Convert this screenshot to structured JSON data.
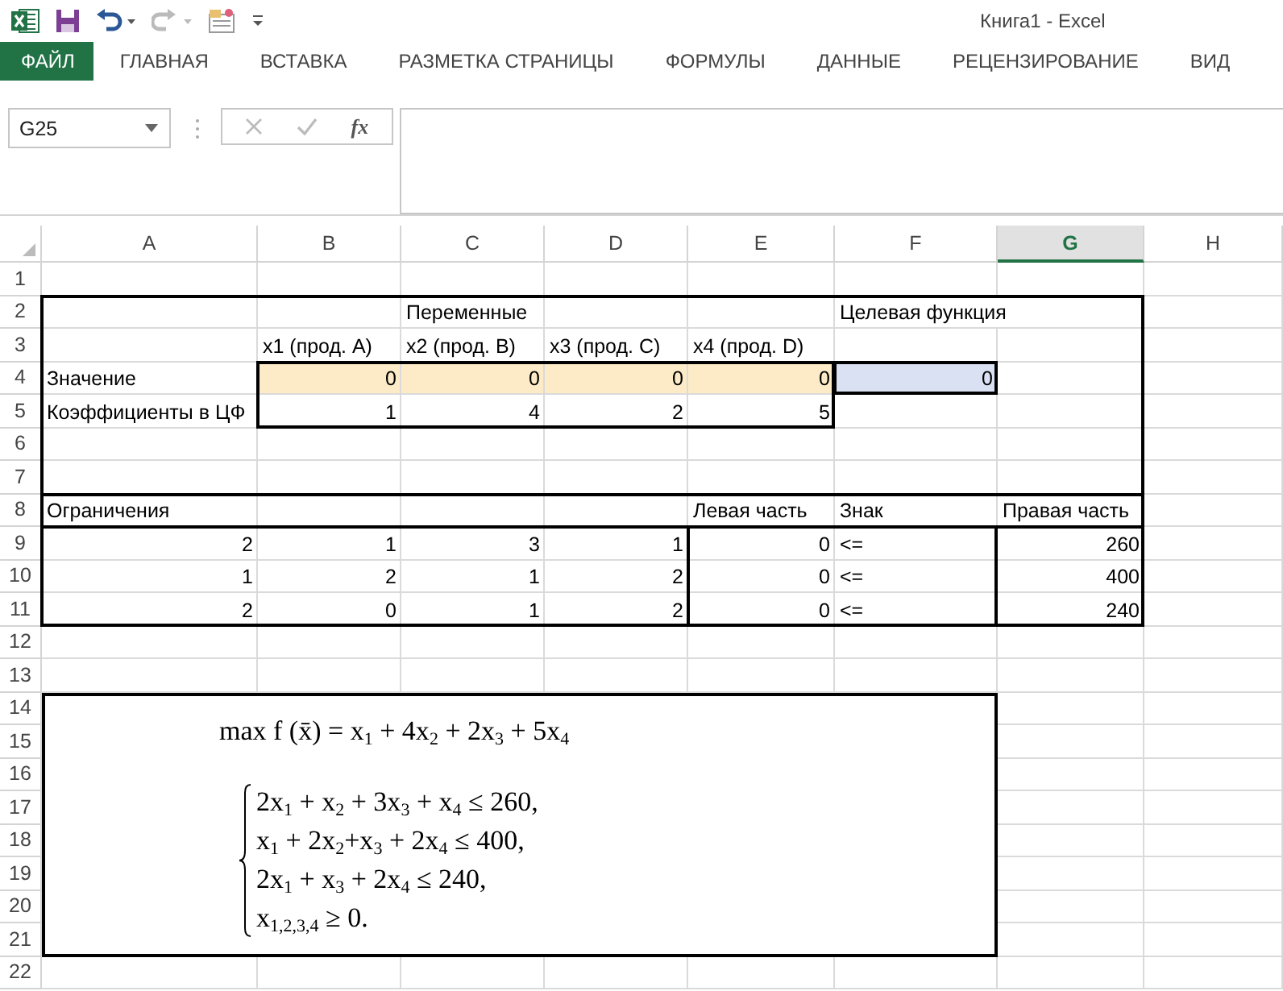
{
  "title_bar": {
    "title": "Книга1 - Excel"
  },
  "ribbon_tabs": [
    {
      "label": "ФАЙЛ",
      "kind": "file"
    },
    {
      "label": "ГЛАВНАЯ",
      "kind": "tab"
    },
    {
      "label": "ВСТАВКА",
      "kind": "tab"
    },
    {
      "label": "РАЗМЕТКА СТРАНИЦЫ",
      "kind": "tab"
    },
    {
      "label": "ФОРМУЛЫ",
      "kind": "tab"
    },
    {
      "label": "ДАННЫЕ",
      "kind": "tab"
    },
    {
      "label": "РЕЦЕНЗИРОВАНИЕ",
      "kind": "tab"
    },
    {
      "label": "ВИД",
      "kind": "tab"
    }
  ],
  "name_box": {
    "value": "G25"
  },
  "formula_bar": {
    "function_label": "fx"
  },
  "columns": [
    {
      "label": "A",
      "selected": false
    },
    {
      "label": "B",
      "selected": false
    },
    {
      "label": "C",
      "selected": false
    },
    {
      "label": "D",
      "selected": false
    },
    {
      "label": "E",
      "selected": false
    },
    {
      "label": "F",
      "selected": false
    },
    {
      "label": "G",
      "selected": true
    },
    {
      "label": "H",
      "selected": false
    }
  ],
  "rows": [
    {
      "label": "1"
    },
    {
      "label": "2",
      "cells": {
        "C": {
          "text": "Переменные",
          "kind": "text"
        },
        "F": {
          "text": "Целевая функция",
          "kind": "text"
        }
      }
    },
    {
      "label": "3",
      "cells": {
        "B": {
          "text": "x1 (прод. A)",
          "kind": "text"
        },
        "C": {
          "text": "x2 (прод. B)",
          "kind": "text"
        },
        "D": {
          "text": "x3 (прод. C)",
          "kind": "text"
        },
        "E": {
          "text": "x4 (прод. D)",
          "kind": "text"
        }
      }
    },
    {
      "label": "4",
      "cells": {
        "A": {
          "text": "Значение",
          "kind": "text"
        },
        "B": {
          "text": "0",
          "kind": "number",
          "color": "#fdebc8"
        },
        "C": {
          "text": "0",
          "kind": "number",
          "color": "#fdebc8"
        },
        "D": {
          "text": "0",
          "kind": "number",
          "color": "#fdebc8"
        },
        "E": {
          "text": "0",
          "kind": "number",
          "color": "#fdebc8"
        },
        "F": {
          "text": "0",
          "kind": "number",
          "color": "#dae1f2"
        }
      }
    },
    {
      "label": "5",
      "cells": {
        "A": {
          "text": "Коэффициенты в ЦФ",
          "kind": "text"
        },
        "B": {
          "text": "1",
          "kind": "number"
        },
        "C": {
          "text": "4",
          "kind": "number"
        },
        "D": {
          "text": "2",
          "kind": "number"
        },
        "E": {
          "text": "5",
          "kind": "number"
        }
      }
    },
    {
      "label": "6"
    },
    {
      "label": "7"
    },
    {
      "label": "8",
      "cells": {
        "A": {
          "text": "Ограничения",
          "kind": "text"
        },
        "E": {
          "text": "Левая часть",
          "kind": "text"
        },
        "F": {
          "text": "Знак",
          "kind": "text"
        },
        "G": {
          "text": "Правая часть",
          "kind": "text"
        }
      }
    },
    {
      "label": "9",
      "cells": {
        "A": {
          "text": "2",
          "kind": "number"
        },
        "B": {
          "text": "1",
          "kind": "number"
        },
        "C": {
          "text": "3",
          "kind": "number"
        },
        "D": {
          "text": "1",
          "kind": "number"
        },
        "E": {
          "text": "0",
          "kind": "number"
        },
        "F": {
          "text": "<=",
          "kind": "text"
        },
        "G": {
          "text": "260",
          "kind": "number"
        }
      }
    },
    {
      "label": "10",
      "cells": {
        "A": {
          "text": "1",
          "kind": "number"
        },
        "B": {
          "text": "2",
          "kind": "number"
        },
        "C": {
          "text": "1",
          "kind": "number"
        },
        "D": {
          "text": "2",
          "kind": "number"
        },
        "E": {
          "text": "0",
          "kind": "number"
        },
        "F": {
          "text": "<=",
          "kind": "text"
        },
        "G": {
          "text": "400",
          "kind": "number"
        }
      }
    },
    {
      "label": "11",
      "cells": {
        "A": {
          "text": "2",
          "kind": "number"
        },
        "B": {
          "text": "0",
          "kind": "number"
        },
        "C": {
          "text": "1",
          "kind": "number"
        },
        "D": {
          "text": "2",
          "kind": "number"
        },
        "E": {
          "text": "0",
          "kind": "number"
        },
        "F": {
          "text": "<=",
          "kind": "text"
        },
        "G": {
          "text": "240",
          "kind": "number"
        }
      }
    },
    {
      "label": "12"
    },
    {
      "label": "13"
    },
    {
      "label": "14"
    },
    {
      "label": "15"
    },
    {
      "label": "16"
    },
    {
      "label": "17"
    },
    {
      "label": "18"
    },
    {
      "label": "19"
    },
    {
      "label": "20"
    },
    {
      "label": "21"
    },
    {
      "label": "22"
    }
  ],
  "equation": {
    "objective": "max f (x̄) = x$_{1}$ + 4x$_{2}$ + 2x$_{3}$ + 5x$_{4}$",
    "constraints": [
      "2x$_{1}$ + x$_{2}$ + 3x$_{3}$ + x$_{4}$ ≤ 260,",
      "x$_{1}$ + 2x$_{2}$+x$_{3}$ + 2x$_{4}$ ≤ 400,",
      "2x$_{1}$ + x$_{3}$ + 2x$_{4}$ ≤ 240,",
      "x$_{1,2,3,4}$ ≥ 0."
    ]
  }
}
